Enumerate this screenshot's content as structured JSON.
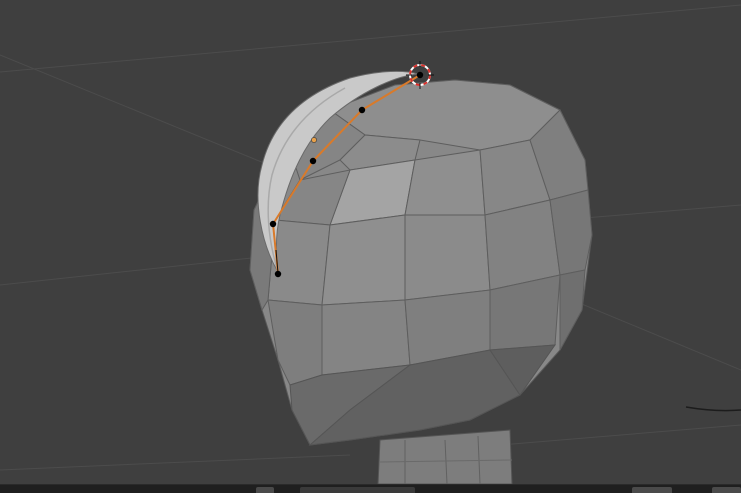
{
  "app": {
    "name": ""
  },
  "viewport": {
    "background": "#3f3f3f",
    "grid_line_color": "#4a4a4a",
    "mesh_face_color": "#8a8a8a",
    "mesh_edge_color": "#5c5c5c",
    "curve_color": "#d97a2a",
    "control_point_color": "#000000",
    "handle_point_color": "#e8a14a",
    "cursor_color": "#d9302c"
  },
  "scene": {
    "mesh_object": "head-mesh",
    "curve_object": "bezier-curve",
    "selected_control_points": 5
  }
}
